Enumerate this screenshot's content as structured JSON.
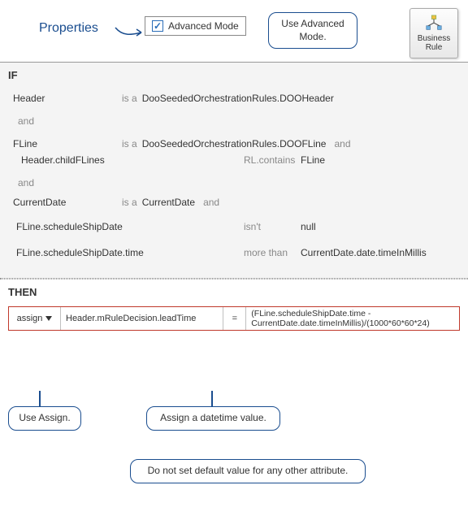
{
  "header": {
    "properties_label": "Properties",
    "advanced_mode_label": "Advanced Mode",
    "callout_advanced": "Use Advanced Mode.",
    "business_rule_label": "Business Rule"
  },
  "if_section": {
    "title": "IF",
    "rows": [
      {
        "name": "Header",
        "op": "is a",
        "val": "DooSeededOrchestrationRules.DOOHeader"
      },
      {
        "sep": "and"
      },
      {
        "name": "FLine",
        "op": "is a",
        "val": "DooSeededOrchestrationRules.DOOFLine",
        "trail": "and"
      },
      {
        "name": "Header.childFLines",
        "op": "RL.contains",
        "val": "FLine"
      },
      {
        "sep": "and"
      },
      {
        "name": "CurrentDate",
        "op": "is a",
        "val": "CurrentDate",
        "trail": "and"
      },
      {
        "name": "FLine.scheduleShipDate",
        "op": "isn't",
        "val": "null"
      },
      {
        "name": "FLine.scheduleShipDate.time",
        "op": "more than",
        "val": "CurrentDate.date.timeInMillis"
      }
    ]
  },
  "then_section": {
    "title": "THEN",
    "assign_label": "assign",
    "target": "Header.mRuleDecision.leadTime",
    "eq": "=",
    "expression": "(FLine.scheduleShipDate.time - CurrentDate.date.timeInMillis)/(1000*60*60*24)"
  },
  "callouts": {
    "use_assign": "Use Assign.",
    "assign_datetime": "Assign a datetime value.",
    "no_default": "Do not set default value for any other attribute."
  }
}
